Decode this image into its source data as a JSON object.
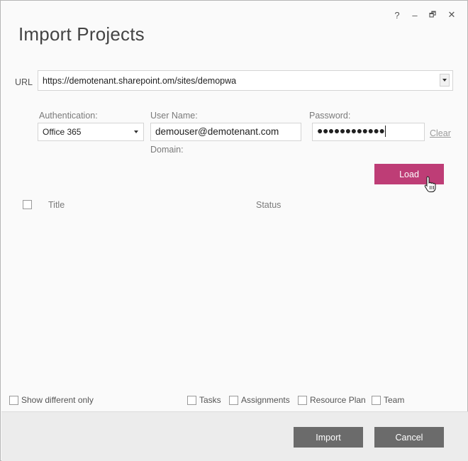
{
  "window": {
    "title": "Import Projects",
    "help_glyph": "?",
    "minimize_glyph": "–",
    "restore_glyph": "🗗",
    "close_glyph": "✕"
  },
  "url": {
    "label": "URL",
    "value": "https://demotenant.sharepoint.om/sites/demopwa"
  },
  "auth": {
    "auth_label": "Authentication:",
    "auth_value": "Office 365",
    "user_label": "User Name:",
    "user_value": "demouser@demotenant.com",
    "domain_label": "Domain:",
    "password_label": "Password:",
    "password_value": "●●●●●●●●●●●●",
    "clear_label": "Clear"
  },
  "load_label": "Load",
  "list": {
    "columns": [
      "Title",
      "Status"
    ],
    "rows": []
  },
  "options": {
    "show_different": "Show different only",
    "tasks": "Tasks",
    "assignments": "Assignments",
    "resource_plan": "Resource Plan",
    "team": "Team"
  },
  "footer": {
    "import_label": "Import",
    "cancel_label": "Cancel"
  },
  "colors": {
    "accent": "#be3d76",
    "footer_button": "#6b6b6b"
  },
  "icons": {
    "help": "help-icon",
    "minimize": "minimize-icon",
    "restore": "restore-icon",
    "close": "close-icon",
    "dropdown": "chevron-down-icon",
    "cursor": "hand-pointer-icon"
  }
}
